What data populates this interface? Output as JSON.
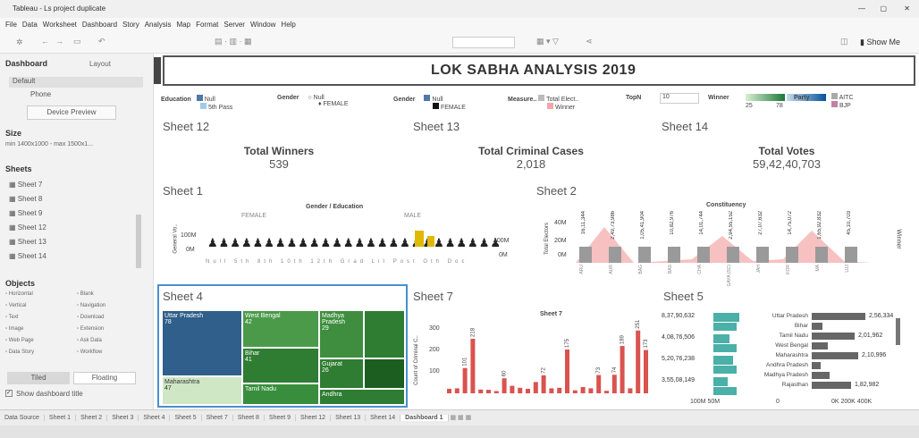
{
  "window_title": "Tableau - Ls project duplicate",
  "menu": [
    "File",
    "Data",
    "Worksheet",
    "Dashboard",
    "Story",
    "Analysis",
    "Map",
    "Format",
    "Server",
    "Window",
    "Help"
  ],
  "toolbar": {
    "show_me": "Show Me"
  },
  "left": {
    "tab_dashboard": "Dashboard",
    "tab_layout": "Layout",
    "devices": [
      "Default",
      "Phone"
    ],
    "device_preview": "Device Preview",
    "size_label": "Size",
    "size_value": "min 1400x1000 - max 1500x1...",
    "sheets_label": "Sheets",
    "sheets": [
      "Sheet 7",
      "Sheet 8",
      "Sheet 9",
      "Sheet 12",
      "Sheet 13",
      "Sheet 14"
    ],
    "objects_label": "Objects",
    "objects": [
      "Horizontal",
      "Blank",
      "Vertical",
      "Navigation",
      "Text",
      "Download",
      "Image",
      "Extension",
      "Web Page",
      "Ask Data",
      "Data Story",
      "Workflow"
    ],
    "tiled": "Tiled",
    "floating": "Floating",
    "show_title": "Show dashboard title"
  },
  "dashboard": {
    "title": "LOK SABHA ANALYSIS 2019",
    "filters": {
      "education": "Education",
      "education_items": [
        "Null",
        "5th Pass"
      ],
      "gender1": "Gender",
      "gender1_items": [
        "Null",
        "FEMALE"
      ],
      "gender2": "Gender",
      "gender2_items": [
        "Null",
        "FEMALE"
      ],
      "measure": "Measure..",
      "measure_items": [
        "Total Elect..",
        "Winner"
      ],
      "topn": "TopN",
      "topn_value": "10",
      "winner": "Winner",
      "winner_range": [
        "25",
        "78"
      ],
      "party": "Party",
      "party_items": [
        "AITC",
        "BJP"
      ]
    },
    "sheet12": "Sheet 12",
    "sheet13": "Sheet 13",
    "sheet14": "Sheet 14",
    "kpis": [
      {
        "title": "Total Winners",
        "value": "539"
      },
      {
        "title": "Total Criminal Cases",
        "value": "2,018"
      },
      {
        "title": "Total Votes",
        "value": "59,42,40,703"
      }
    ],
    "sheet1": "Sheet 1",
    "sheet1_header": "Gender / Education",
    "sheet1_female": "FEMALE",
    "sheet1_male": "MALE",
    "sheet1_yaxis": "General Vo..",
    "sheet1_ticks": [
      "100M",
      "0M"
    ],
    "sheet2": "Sheet 2",
    "sheet2_header": "Constituency",
    "sheet2_yaxis": "Total Electors",
    "sheet2_ticks": [
      "40M",
      "20M",
      "0M"
    ],
    "sheet2_right": "Winner",
    "sheet2_labels": [
      "16,11,344",
      "2,49,73,986",
      "1,05,41,904",
      "10,82,976",
      "14,01,744",
      "2,94,55,152",
      "27,07,632",
      "14,75,072",
      "1,65,92,832",
      "45,10,703"
    ],
    "sheet2_cats": [
      "ARU",
      "AUR",
      "BAG",
      "BAS",
      "CHA",
      "GAYA (SC)",
      "JAH",
      "KOR",
      "MA",
      "UJJ"
    ],
    "sheet4": "Sheet 4",
    "tree": [
      {
        "name": "Uttar Pradesh",
        "v": "78"
      },
      {
        "name": "West Bengal",
        "v": "42"
      },
      {
        "name": "Madhya Pradesh",
        "v": "29"
      },
      {
        "name": "Bihar",
        "v": "41"
      },
      {
        "name": "Gujarat",
        "v": "26"
      },
      {
        "name": "Maharashtra",
        "v": "47"
      },
      {
        "name": "Tamil Nadu",
        "v": "39"
      },
      {
        "name": "Andhra",
        "v": ""
      }
    ],
    "sheet7": "Sheet 7",
    "sheet7_header": "State",
    "sheet7_yaxis": "Count of Criminal C..",
    "sheet7_ticks": [
      "300",
      "200",
      "100"
    ],
    "sheet5": "Sheet 5",
    "sheet5_left": [
      "8,37,90,632",
      "4,08,76,506",
      "5,20,76,238",
      "3,55,08,149"
    ],
    "sheet5_left_axis": "100M 50M",
    "sheet5_states": [
      "Uttar Pradesh",
      "Bihar",
      "Tamil Nadu",
      "West Bengal",
      "Maharashtra",
      "Andhra Pradesh",
      "Madhya Pradesh",
      "Rajasthan"
    ],
    "sheet5_right": [
      "2,56,334",
      "2,01,962",
      "2,10,996",
      "1,82,982"
    ],
    "sheet5_axis_left": "0",
    "sheet5_axis_right": "0K  200K  400K"
  },
  "chart_data": [
    {
      "type": "bar",
      "title": "Sheet 7",
      "xlabel": "",
      "ylabel": "Count of Criminal C..",
      "ylim": [
        0,
        300
      ],
      "values": [
        18,
        20,
        101,
        218,
        15,
        14,
        9,
        60,
        30,
        22,
        18,
        45,
        72,
        20,
        22,
        175,
        12,
        25,
        20,
        73,
        10,
        74,
        189,
        20,
        251,
        173
      ]
    }
  ],
  "tabs": [
    "Data Source",
    "Sheet 1",
    "Sheet 2",
    "Sheet 3",
    "Sheet 4",
    "Sheet 5",
    "Sheet 7",
    "Sheet 8",
    "Sheet 9",
    "Sheet 12",
    "Sheet 13",
    "Sheet 14",
    "Dashboard 1"
  ]
}
